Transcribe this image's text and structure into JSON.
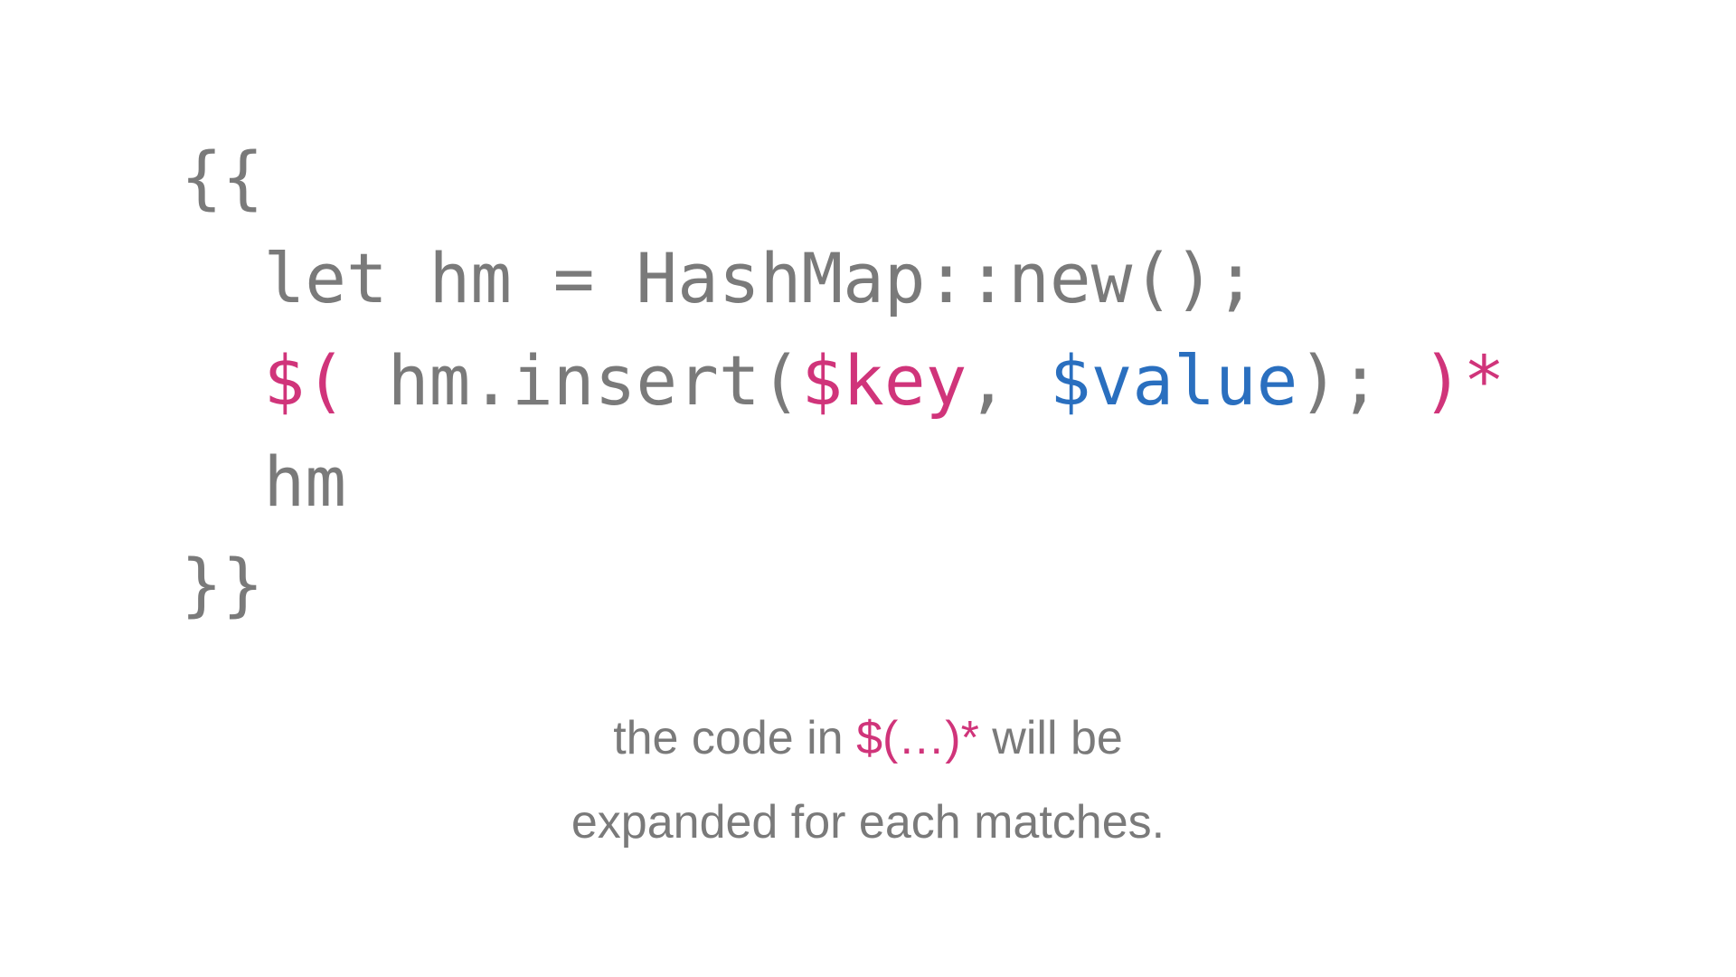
{
  "code": {
    "line1": "{{",
    "line2_indent": "  ",
    "line2_rest": "let hm = HashMap::new();",
    "line3_indent": "  ",
    "line3_p1": "$(",
    "line3_p2": " hm.insert(",
    "line3_key": "$key",
    "line3_comma": ", ",
    "line3_value": "$value",
    "line3_close": "); ",
    "line3_end": ")*",
    "line4_indent": "  ",
    "line4_rest": "hm",
    "line5": "}}"
  },
  "caption": {
    "pre": "the code in ",
    "highlight": "$(…)*",
    "post": " will be",
    "line2": "expanded for each matches."
  }
}
